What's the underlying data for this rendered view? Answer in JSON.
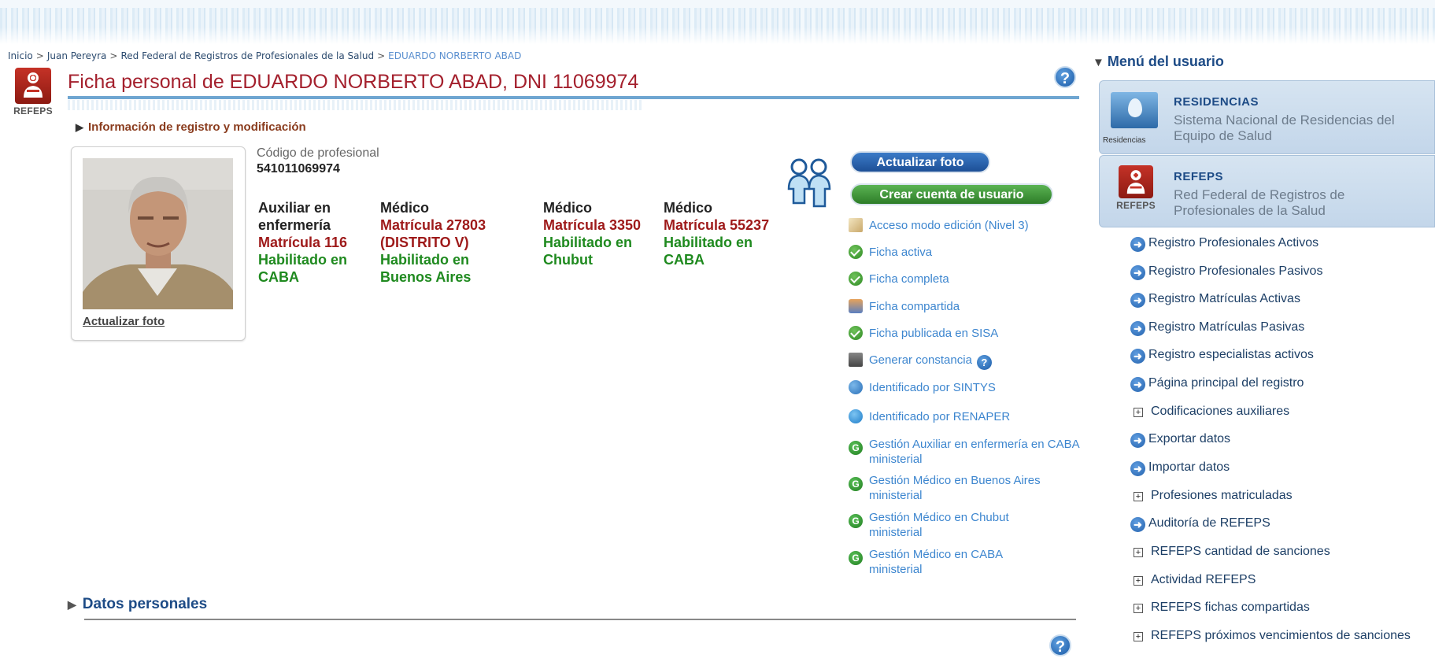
{
  "breadcrumb": {
    "items": [
      "Inicio",
      "Juan Pereyra",
      "Red Federal de Registros de Profesionales de la Salud"
    ],
    "current": "EDUARDO NORBERTO ABAD",
    "separator": ">"
  },
  "logo": {
    "label": "REFEPS"
  },
  "page_title": "Ficha personal de EDUARDO NORBERTO ABAD, DNI 11069974",
  "help_icon": "?",
  "info_registro": "Información de registro y modificación",
  "photo": {
    "link": "Actualizar foto"
  },
  "codigo": {
    "label": "Código de profesional",
    "value": "541011069974"
  },
  "profesiones": [
    {
      "titulo": "Auxiliar en enfermería",
      "matricula": "Matrícula 116",
      "habilitado": "Habilitado en CABA"
    },
    {
      "titulo": "Médico",
      "matricula": "Matrícula 27803 (DISTRITO V)",
      "habilitado": "Habilitado en Buenos Aires"
    },
    {
      "titulo": "Médico",
      "matricula": "Matrícula 3350",
      "habilitado": "Habilitado en Chubut"
    },
    {
      "titulo": "Médico",
      "matricula": "Matrícula 55237",
      "habilitado": "Habilitado en CABA"
    }
  ],
  "buttons": {
    "actualizar_foto": "Actualizar foto",
    "crear_cuenta": "Crear cuenta de usuario"
  },
  "status": [
    {
      "icon": "edit-icon",
      "text": "Acceso modo edición (Nivel 3)"
    },
    {
      "icon": "check-icon",
      "text": "Ficha activa"
    },
    {
      "icon": "check-icon",
      "text": "Ficha completa"
    },
    {
      "icon": "share-icon",
      "text": "Ficha compartida"
    },
    {
      "icon": "check-icon",
      "text": "Ficha publicada en SISA"
    },
    {
      "icon": "print-icon",
      "text": "Generar constancia"
    },
    {
      "icon": "sintys-icon",
      "text": "Identificado por SINTYS"
    },
    {
      "icon": "fingerprint-icon",
      "text": "Identificado por RENAPER"
    },
    {
      "icon": "g-icon",
      "text": "Gestión Auxiliar en enfermería en CABA ministerial"
    },
    {
      "icon": "g-icon",
      "text": "Gestión Médico en Buenos Aires ministerial"
    },
    {
      "icon": "g-icon",
      "text": "Gestión Médico en Chubut ministerial"
    },
    {
      "icon": "g-icon",
      "text": "Gestión Médico en CABA ministerial"
    }
  ],
  "datos_personales": "Datos personales",
  "menu": {
    "title": "Menú del usuario",
    "systems": [
      {
        "title": "RESIDENCIAS",
        "desc1": "Sistema Nacional de Residencias del",
        "desc2": "Equipo de Salud",
        "logo_label": "Residencias"
      },
      {
        "title": "REFEPS",
        "desc1": "Red Federal de Registros de",
        "desc2": "Profesionales de la Salud",
        "logo_label": "REFEPS"
      }
    ],
    "items": [
      {
        "type": "arrow",
        "label": "Registro Profesionales Activos"
      },
      {
        "type": "arrow",
        "label": "Registro Profesionales Pasivos"
      },
      {
        "type": "arrow",
        "label": "Registro Matrículas Activas"
      },
      {
        "type": "arrow",
        "label": "Registro Matrículas Pasivas"
      },
      {
        "type": "arrow",
        "label": "Registro especialistas activos"
      },
      {
        "type": "arrow",
        "label": "Página principal del registro"
      },
      {
        "type": "plus",
        "label": "Codificaciones auxiliares"
      },
      {
        "type": "arrow",
        "label": "Exportar datos"
      },
      {
        "type": "arrow",
        "label": "Importar datos"
      },
      {
        "type": "plus",
        "label": "Profesiones matriculadas"
      },
      {
        "type": "arrow",
        "label": "Auditoría de REFEPS"
      },
      {
        "type": "plus",
        "label": "REFEPS cantidad de sanciones"
      },
      {
        "type": "plus",
        "label": "Actividad REFEPS"
      },
      {
        "type": "plus",
        "label": "REFEPS fichas compartidas"
      },
      {
        "type": "plus",
        "label": "REFEPS próximos vencimientos de sanciones"
      }
    ]
  }
}
